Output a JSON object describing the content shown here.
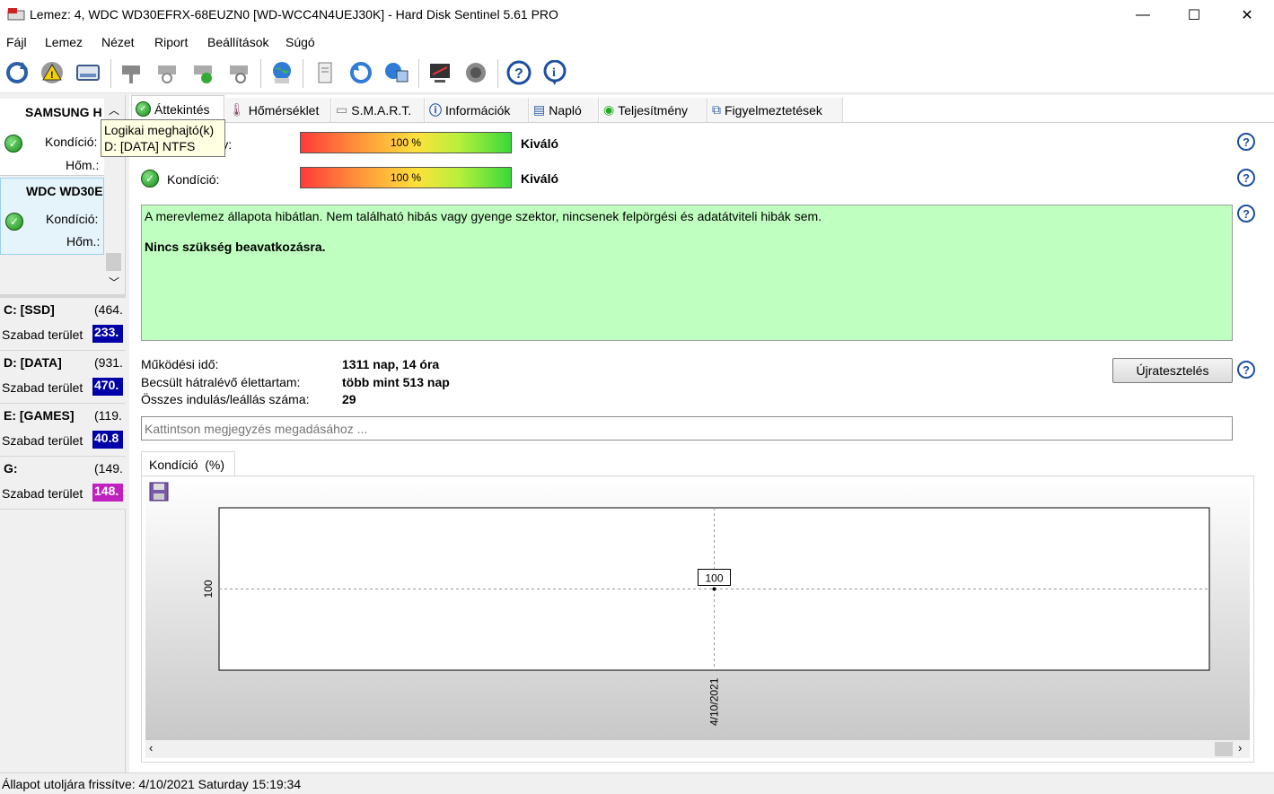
{
  "window": {
    "title": "Lemez: 4, WDC WD30EFRX-68EUZN0 [WD-WCC4N4UEJ30K]  -  Hard Disk Sentinel 5.61 PRO",
    "minimize": "—",
    "maximize": "☐",
    "close": "✕"
  },
  "menu": [
    "Fájl",
    "Lemez",
    "Nézet",
    "Riport",
    "Beállítások",
    "Súgó"
  ],
  "toolbar": {
    "icons": [
      "refresh-icon",
      "warning-icon",
      "disk-icon",
      "test-icon-1",
      "test-icon-2",
      "test-icon-3",
      "test-icon-4",
      "web-icon",
      "report-icon",
      "sync-icon",
      "network-icon",
      "monitor-icon",
      "sound-icon",
      "help-icon",
      "info-icon"
    ]
  },
  "sidebar": {
    "disks": [
      {
        "name": "SAMSUNG H",
        "condition_label": "Kondíció:",
        "temp_label": "Hőm.:"
      },
      {
        "name": "WDC WD30E",
        "condition_label": "Kondíció:",
        "temp_label": "Hőm.:"
      }
    ],
    "volumes": [
      {
        "name": "C: [SSD]",
        "size": "(464.",
        "free_label": "Szabad terület",
        "free": "233.",
        "color": "#0000a8"
      },
      {
        "name": "D: [DATA]",
        "size": "(931.",
        "free_label": "Szabad terület",
        "free": "470.",
        "color": "#0000a8"
      },
      {
        "name": "E: [GAMES]",
        "size": "(119.",
        "free_label": "Szabad terület",
        "free": "40.8",
        "color": "#0000a8"
      },
      {
        "name": "G:",
        "size": "(149.",
        "free_label": "Szabad terület",
        "free": "148.",
        "color": "#c020c0"
      }
    ],
    "tooltip": {
      "line1": "Logikai meghajtó(k)",
      "line2": "D: [DATA] NTFS"
    }
  },
  "tabs": [
    "Áttekintés",
    "Hőmérséklet",
    "S.M.A.R.T.",
    "Információk",
    "Napló",
    "Teljesítmény",
    "Figyelmeztetések"
  ],
  "overview": {
    "performance": {
      "label": "...ény:",
      "value_text": "100 %",
      "value": 100,
      "rating": "Kiváló"
    },
    "condition": {
      "label": "Kondíció:",
      "value_text": "100 %",
      "value": 100,
      "rating": "Kiváló"
    },
    "message1": "A merevlemez állapota hibátlan. Nem található hibás vagy gyenge szektor, nincsenek felpörgési és adatátviteli hibák sem.",
    "message2": "Nincs szükség beavatkozásra.",
    "stats": [
      {
        "label": "Működési idő:",
        "value": "1311 nap, 14 óra"
      },
      {
        "label": "Becsült hátralévő élettartam:",
        "value": "több mint 513 nap"
      },
      {
        "label": "Összes indulás/leállás száma:",
        "value": "29"
      }
    ],
    "retest_button": "Újratesztelés",
    "note_placeholder": "Kattintson megjegyzés megadásához ..."
  },
  "chart_tab": "Kondíció  (%)",
  "chart_data": {
    "type": "line",
    "x": [
      "4/10/2021"
    ],
    "series": [
      {
        "values": [
          100
        ]
      }
    ],
    "ylabel_tick": "100",
    "point_label": "100"
  },
  "status": "Állapot utoljára frissítve: 4/10/2021 Saturday 15:19:34"
}
